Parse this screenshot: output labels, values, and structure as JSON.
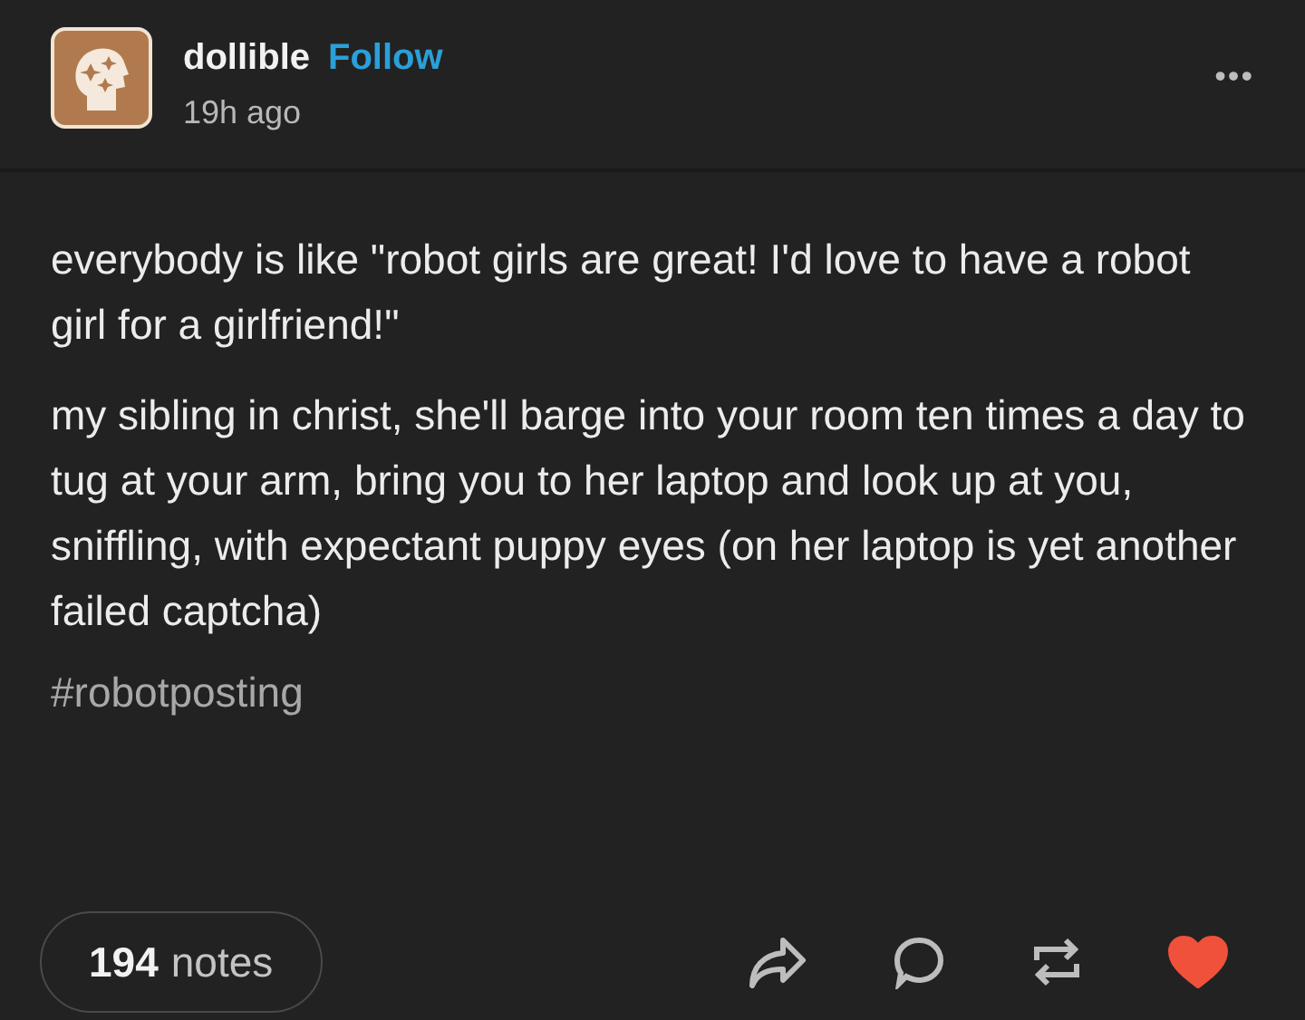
{
  "post": {
    "username": "dollible",
    "follow": "Follow",
    "time": "19h ago",
    "more": "•••"
  },
  "body": [
    "everybody is like \"robot girls are great! I'd love to have a robot girl for a girlfriend!\"",
    "my sibling in christ, she'll barge into your room ten times a day to tug at your arm, bring you to her laptop and look up at you, sniffling, with expectant puppy eyes (on her laptop is yet another failed captcha)"
  ],
  "tags": [
    "#robotposting"
  ],
  "footer": {
    "notes_count": "194",
    "notes_label": "notes",
    "liked": true
  }
}
